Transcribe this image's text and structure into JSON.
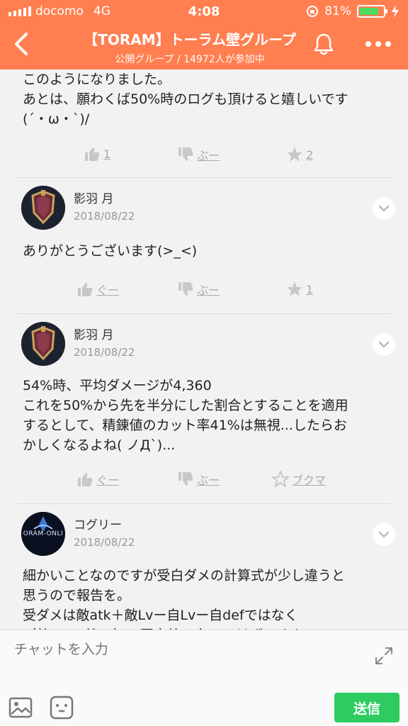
{
  "status_bar": {
    "carrier": "docomo",
    "network": "4G",
    "time": "4:08",
    "battery": "81%",
    "battery_level": 0.81
  },
  "header": {
    "title": "【TORAM】トーラム壁グループ",
    "subtitle": "公開グループ / 14972人が参加中"
  },
  "posts": [
    {
      "text": "このようになりました。\nあとは、願わくば50%時のログも頂けると嬉しいです\n(´・ω・`)/",
      "actions": {
        "like": "1",
        "dislike": "ぶー",
        "star": "2"
      }
    },
    {
      "author": "影羽 月",
      "date": "2018/08/22",
      "text": "ありがとうございます(>_<)",
      "actions": {
        "like": "ぐー",
        "dislike": "ぶー",
        "star": "1"
      }
    },
    {
      "author": "影羽 月",
      "date": "2018/08/22",
      "text": "54%時、平均ダメージが4,360\nこれを50%から先を半分にした割合とすることを適用\nするとして、精錬値のカット率41%は無視...したらお\nかしくなるよね( ノД`)...",
      "actions": {
        "like": "ぐー",
        "dislike": "ぶー",
        "star": "ブクマ"
      }
    },
    {
      "author": "コグリー",
      "date": "2018/08/22",
      "avatar_text": "ORAM-ONLI",
      "text": "細かいことなのですが受白ダメの計算式が少し違うと\n思うので報告を。\n受ダメは敵atk＋敵Lvー自Lvー自defではなく\n（敵atk＋敵Lv）ｘ固定値ー自Lvのはずですよ"
    }
  ],
  "composer": {
    "placeholder": "チャットを入力",
    "send_label": "送信"
  },
  "colors": {
    "header_bg": "#ff7f50",
    "send_bg": "#2ecc60",
    "battery_fill": "#4cd964"
  }
}
